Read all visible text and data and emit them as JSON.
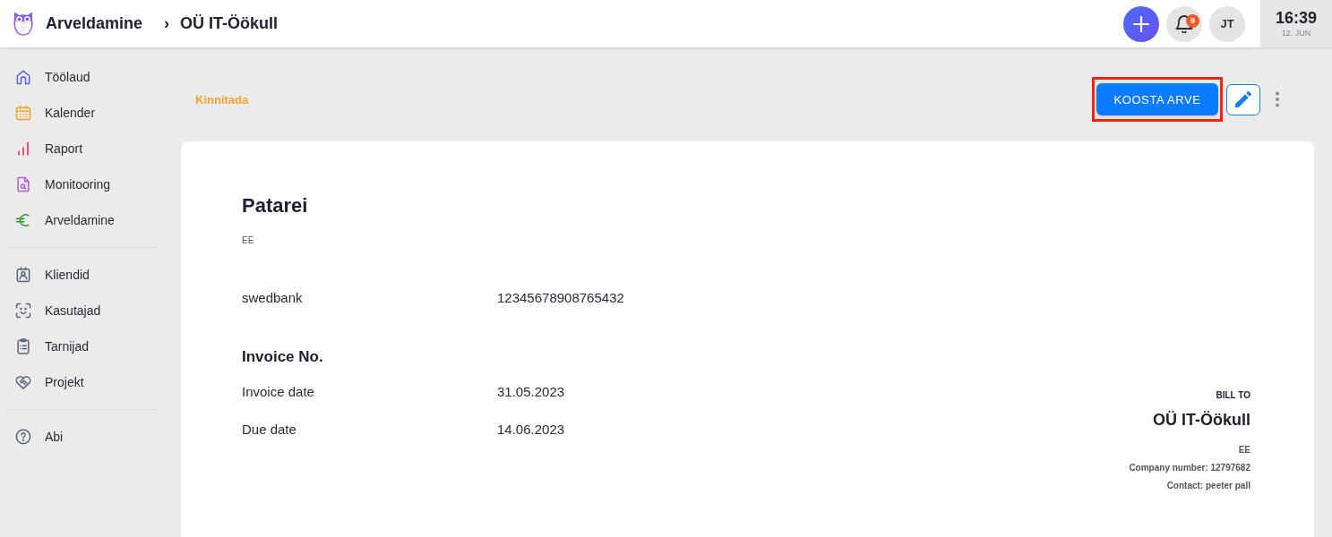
{
  "header": {
    "breadcrumb": [
      {
        "label": "Arveldamine"
      },
      {
        "label": "OÜ IT-Öökull"
      }
    ],
    "separator": "›",
    "notifications_count": "9",
    "avatar_initials": "JT",
    "clock": {
      "time": "16:39",
      "date": "12. JUN"
    }
  },
  "sidebar": {
    "sections": [
      {
        "items": [
          {
            "label": "Töölaud",
            "color": "#5b5fd6",
            "selected": false
          },
          {
            "label": "Kalender",
            "color": "#f5a020",
            "selected": false
          },
          {
            "label": "Raport",
            "color": "#e2466c",
            "selected": false
          },
          {
            "label": "Monitooring",
            "color": "#b05fd6",
            "selected": false
          },
          {
            "label": "Arveldamine",
            "color": "#2ea02e",
            "selected": false
          }
        ]
      },
      {
        "items": [
          {
            "label": "Kliendid",
            "color": "#5a6478",
            "selected": false
          },
          {
            "label": "Kasutajad",
            "color": "#5a6478",
            "selected": false
          },
          {
            "label": "Tarnijad",
            "color": "#5a6478",
            "selected": false
          },
          {
            "label": "Projekt",
            "color": "#5a6478",
            "selected": false
          }
        ]
      },
      {
        "items": [
          {
            "label": "Abi",
            "color": "#5a6478",
            "selected": false
          }
        ]
      }
    ]
  },
  "toolbar": {
    "status": "Kinnitada",
    "primary_button": {
      "label": "KOOSTA ARVE",
      "highlighted": true
    }
  },
  "invoice": {
    "company_name": "Patarei",
    "company_country": "EE",
    "bank": {
      "name": "swedbank",
      "account": "12345678908765432"
    },
    "invoice_no_label": "Invoice No.",
    "dates": [
      {
        "label": "Invoice date",
        "value": "31.05.2023"
      },
      {
        "label": "Due date",
        "value": "14.06.2023"
      }
    ],
    "bill_to": {
      "heading": "BILL TO",
      "name": "OÜ IT-Öökull",
      "country": "EE",
      "lines": [
        "Company number: 12797682",
        "Contact: peeter pall"
      ]
    }
  }
}
